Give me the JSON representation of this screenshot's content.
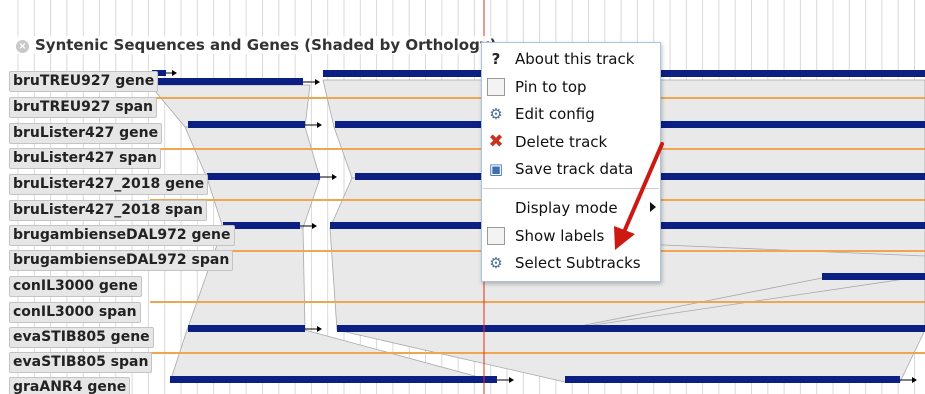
{
  "track": {
    "title": "Syntenic Sequences and Genes (Shaded by Orthology)",
    "labels": [
      "bruTREU927 gene",
      "bruTREU927 span",
      "bruLister427 gene",
      "bruLister427 span",
      "bruLister427_2018 gene",
      "bruLister427_2018 span",
      "brugambienseDAL972 gene",
      "brugambienseDAL972 span",
      "conIL3000 gene",
      "conIL3000 span",
      "evaSTIB805 gene",
      "evaSTIB805 span",
      "graANR4 gene"
    ]
  },
  "menu": {
    "items": [
      {
        "label": "About this track",
        "icon": "help-icon"
      },
      {
        "label": "Pin to top",
        "icon": "pin-checkbox-icon"
      },
      {
        "label": "Edit config",
        "icon": "gear-icon"
      },
      {
        "label": "Delete track",
        "icon": "delete-x-icon"
      },
      {
        "label": "Save track data",
        "icon": "save-disk-icon"
      },
      {
        "label": "Display mode",
        "icon": "submenu-arrow-icon"
      },
      {
        "label": "Show labels",
        "icon": "checkbox-icon"
      },
      {
        "label": "Select Subtracks",
        "icon": "gear-icon"
      }
    ]
  },
  "colors": {
    "gene": "#0c1f82",
    "span": "#f0a64e",
    "shade": "#e9e9e9",
    "shade_stroke": "#a8a8a8",
    "grid": "#d9d9d9",
    "cursor_line": "#e0301e",
    "annotation_arrow": "#cc1a12"
  }
}
